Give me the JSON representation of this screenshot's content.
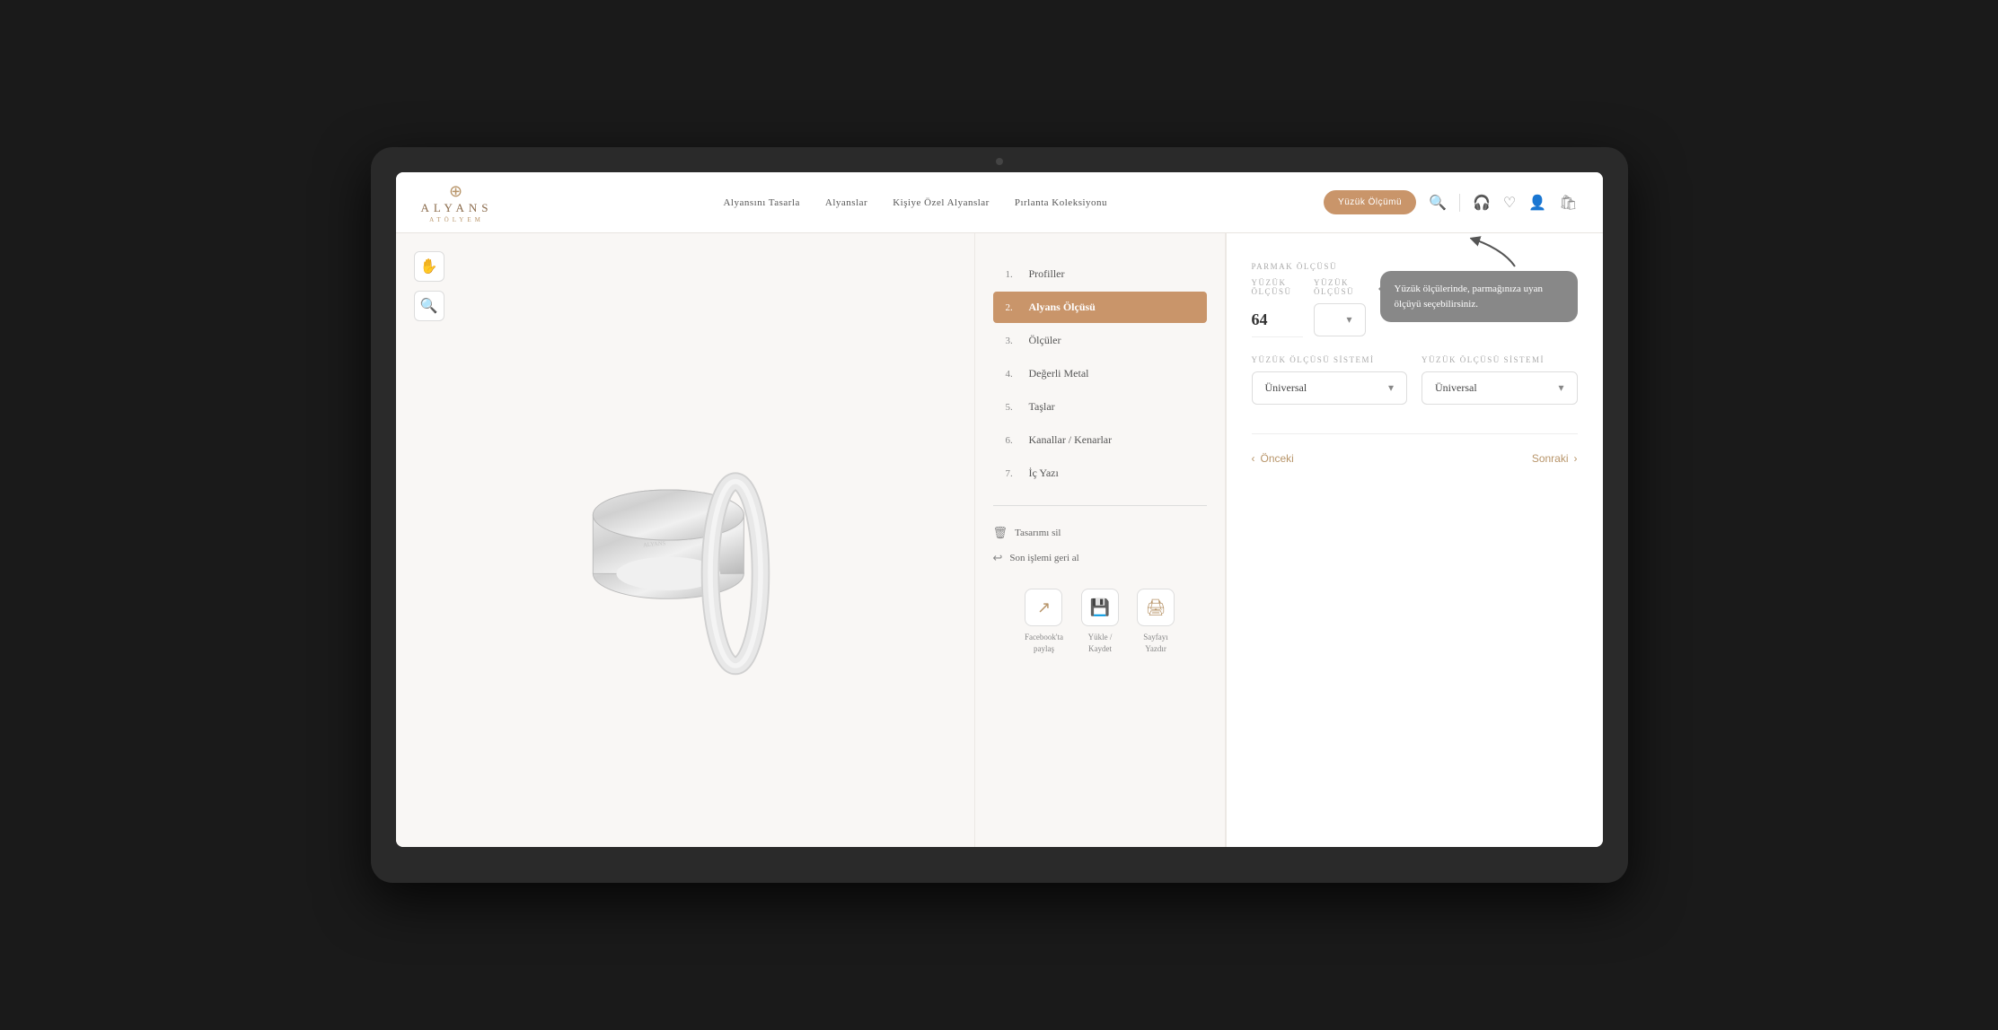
{
  "device": {
    "camera_dot": true
  },
  "header": {
    "logo_rings": "⊕",
    "logo_name": "ALYANS",
    "logo_sub": "ATÖLYEM",
    "nav_items": [
      "Alyansını Tasarla",
      "Alyanslar",
      "Kişiye Özel Alyanslar",
      "Pırlanta Koleksiyonu"
    ],
    "ring_size_btn": "Yüzük Ölçümü",
    "icons": [
      "search",
      "headset",
      "heart",
      "user",
      "cart"
    ]
  },
  "steps": {
    "items": [
      {
        "num": "1.",
        "label": "Profiller",
        "active": false
      },
      {
        "num": "2.",
        "label": "Alyans Ölçüsü",
        "active": true
      },
      {
        "num": "3.",
        "label": "Ölçüler",
        "active": false
      },
      {
        "num": "4.",
        "label": "Değerli Metal",
        "active": false
      },
      {
        "num": "5.",
        "label": "Taşlar",
        "active": false
      },
      {
        "num": "6.",
        "label": "Kanallar / Kenarlar",
        "active": false
      },
      {
        "num": "7.",
        "label": "İç Yazı",
        "active": false
      }
    ],
    "delete_design": "Tasarımı sil",
    "undo": "Son işlemi geri al",
    "social": [
      {
        "icon": "share",
        "label": "Facebook'ta\npaylaş"
      },
      {
        "icon": "save",
        "label": "Yükle /\nKaydet"
      },
      {
        "icon": "print",
        "label": "Sayfayı\nYazdır"
      }
    ]
  },
  "config": {
    "parmak_label": "Parmak Ölçüsü",
    "ring_size_label": "YÜZÜK ÖLÇÜSÜ",
    "ring_size_value": "64",
    "ring_size_label2": "YÜZÜK ÖLÇÜSÜ",
    "ring_size_value2": "",
    "tooltip_text": "Yüzük ölçülerinde, parmağınıza uyan ölçüyü seçebilirsiniz.",
    "system_label1": "YÜZÜK ÖLÇÜSÜ SİSTEMİ",
    "system_value1": "Üniversal",
    "system_label2": "YÜZÜK ÖLÇÜSÜ SİSTEMİ",
    "system_value2": "Üniversal",
    "prev_btn": "Önceki",
    "next_btn": "Sonraki"
  }
}
